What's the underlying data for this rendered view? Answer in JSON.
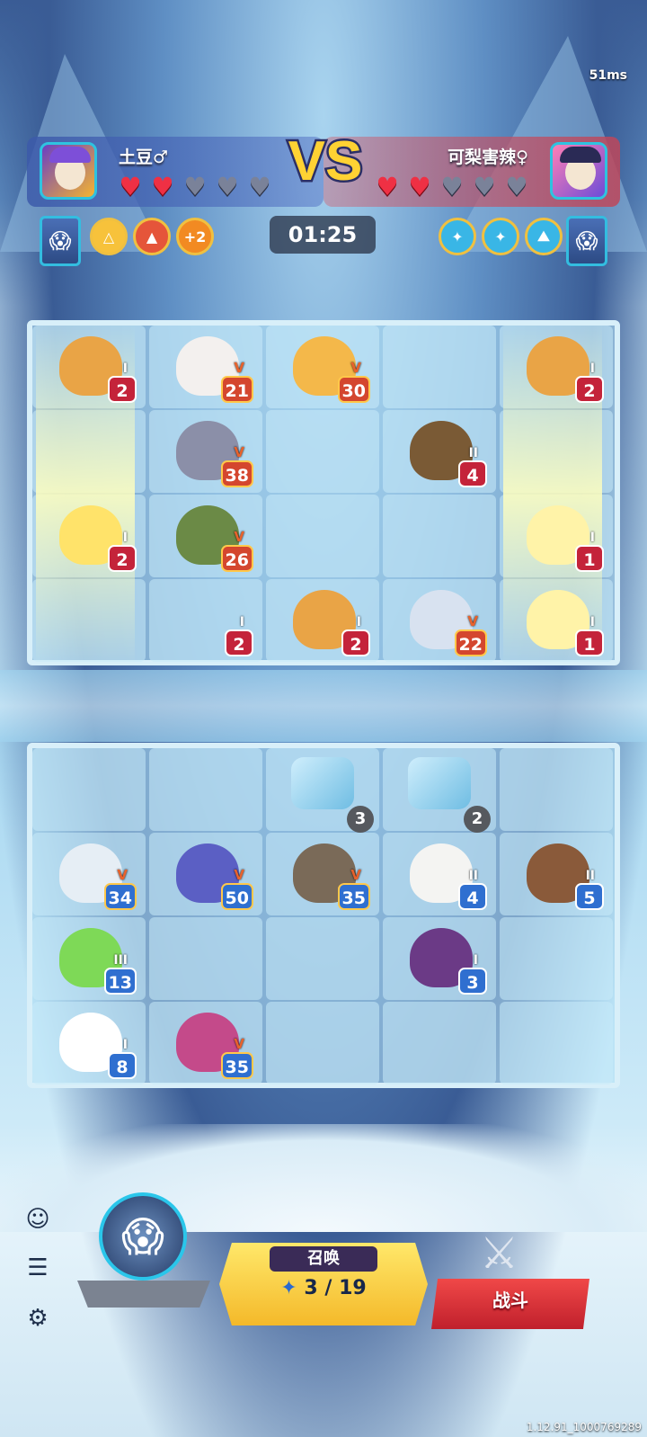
{
  "ping": "51ms",
  "left_player": {
    "name": "土豆♂",
    "hearts": [
      "full",
      "full",
      "empty",
      "empty",
      "empty"
    ]
  },
  "right_player": {
    "name": "可梨害辣♀",
    "hearts": [
      "full",
      "full",
      "empty",
      "empty",
      "empty"
    ]
  },
  "vs_label": "VS",
  "timer": "01:25",
  "left_skills": [
    {
      "icon": "triangle-icon",
      "label": ""
    },
    {
      "icon": "arrow-up-icon",
      "label": ""
    },
    {
      "icon": "plus-badge",
      "label": "+2"
    }
  ],
  "right_skills": [
    {
      "icon": "star-icon",
      "label": ""
    },
    {
      "icon": "star-icon",
      "label": ""
    },
    {
      "icon": "mountain-icon",
      "label": ""
    }
  ],
  "enemy_units": [
    {
      "name": "turtle",
      "level": "2",
      "rank": "I"
    },
    {
      "name": "wizard-cat",
      "level": "21",
      "rank": "V"
    },
    {
      "name": "bird-warrior",
      "level": "30",
      "rank": "V"
    },
    {
      "name": "turtle",
      "level": "2",
      "rank": "I"
    },
    {
      "name": "rabbit-police",
      "level": "38",
      "rank": "V"
    },
    {
      "name": "big-turtle",
      "level": "4",
      "rank": "II"
    },
    {
      "name": "sun-spirit",
      "level": "2",
      "rank": "I"
    },
    {
      "name": "spiked-tortoise",
      "level": "26",
      "rank": "V"
    },
    {
      "name": "ghost-spirit",
      "level": "1",
      "rank": "I"
    },
    {
      "name": "empty",
      "level": "2",
      "rank": "I"
    },
    {
      "name": "turtle",
      "level": "2",
      "rank": "I"
    },
    {
      "name": "winged-wolf",
      "level": "22",
      "rank": "V"
    },
    {
      "name": "rabbit-ghost",
      "level": "1",
      "rank": "I"
    }
  ],
  "ice_blocks": [
    {
      "count": "3"
    },
    {
      "count": "2"
    }
  ],
  "player_units": [
    {
      "name": "ice-yeti",
      "level": "34",
      "rank": "V"
    },
    {
      "name": "shark-mage",
      "level": "50",
      "rank": "V"
    },
    {
      "name": "sloth",
      "level": "35",
      "rank": "V"
    },
    {
      "name": "polar-bear",
      "level": "4",
      "rank": "II"
    },
    {
      "name": "deer",
      "level": "5",
      "rank": "II"
    },
    {
      "name": "centaur-girl",
      "level": "13",
      "rank": "III"
    },
    {
      "name": "bat",
      "level": "3",
      "rank": "I"
    },
    {
      "name": "baby-bear",
      "level": "8",
      "rank": "I"
    },
    {
      "name": "demon-queen",
      "level": "35",
      "rank": "V"
    }
  ],
  "summon": {
    "label": "召唤",
    "cost": "3 / 19"
  },
  "battle": {
    "label": "战斗"
  },
  "version": "1.12.91_1000769289"
}
